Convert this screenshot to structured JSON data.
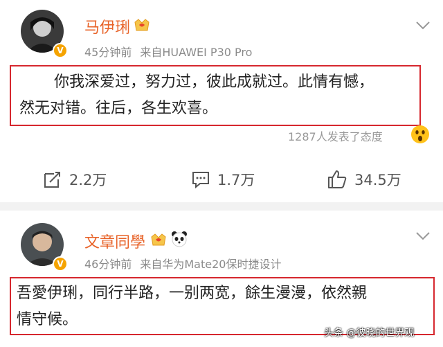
{
  "posts": [
    {
      "username": "马伊琍",
      "time": "45分钟前",
      "source": "来自HUAWEI P30 Pro",
      "lines": [
        "你我深爱过，努力过，彼此成就过。此情有憾，",
        "然无对错。往后，各生欢喜。"
      ],
      "reactions_text": "1287人发表了态度",
      "reposts": "2.2万",
      "comments": "1.7万",
      "likes": "34.5万"
    },
    {
      "username": "文章同學",
      "time": "46分钟前",
      "source": "来自华为Mate20保时捷设计",
      "lines": [
        "吾愛伊琍，同行半路，一别两宽，餘生漫漫，依然親",
        "情守候。"
      ]
    }
  ],
  "watermark": "头条 @彼晓的世界观",
  "colors": {
    "username": "#e8642a",
    "highlight_border": "#d6272e",
    "verified_badge": "#f5a300"
  },
  "icons": [
    "chevron-down-icon",
    "verified-badge-icon",
    "crown-badge-icon",
    "panda-icon",
    "repost-icon",
    "comment-icon",
    "like-icon",
    "wow-emoji-icon"
  ]
}
